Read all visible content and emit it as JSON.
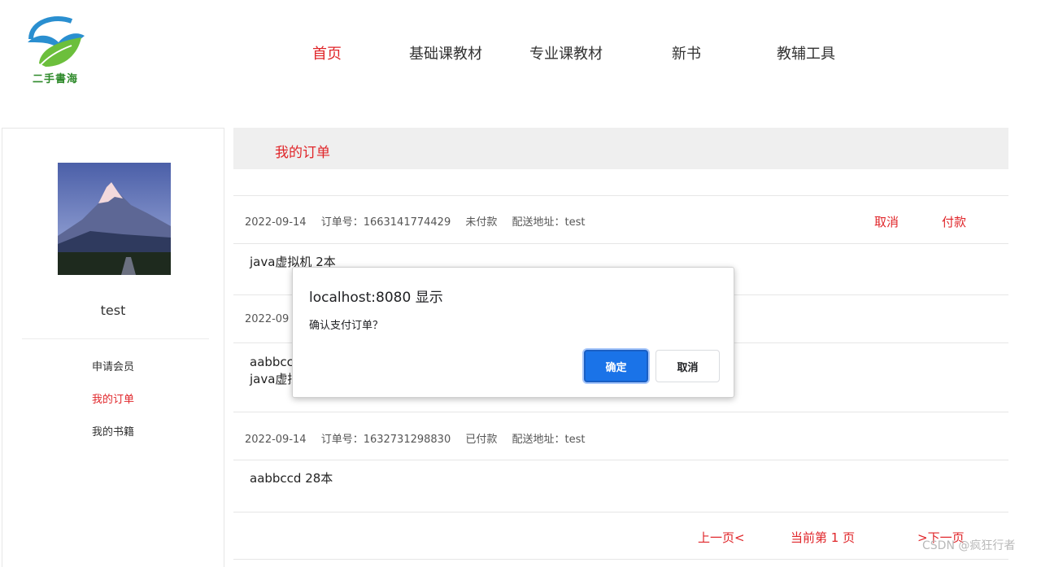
{
  "header": {
    "logo_text": "二手書海",
    "nav": [
      {
        "label": "首页",
        "active": true
      },
      {
        "label": "基础课教材",
        "active": false
      },
      {
        "label": "专业课教材",
        "active": false
      },
      {
        "label": "新书",
        "active": false
      },
      {
        "label": "教辅工具",
        "active": false
      }
    ]
  },
  "sidebar": {
    "username": "test",
    "links": [
      {
        "label": "申请会员",
        "active": false
      },
      {
        "label": "我的订单",
        "active": true
      },
      {
        "label": "我的书籍",
        "active": false
      }
    ]
  },
  "main": {
    "title": "我的订单",
    "orders": [
      {
        "date": "2022-09-14",
        "order_no": "订单号：1663141774429",
        "status": "未付款",
        "address": "配送地址：test",
        "actions": [
          "取消",
          "付款"
        ],
        "items": [
          "java虚拟机 2本"
        ]
      },
      {
        "date": "2022-09",
        "items": [
          "aabbcc",
          "java虚拟"
        ]
      },
      {
        "date": "2022-09-14",
        "order_no": "订单号：1632731298830",
        "status": "已付款",
        "address": "配送地址：test",
        "items": [
          "aabbccd 28本"
        ]
      }
    ],
    "pager": {
      "prev": "上一页<",
      "current": "当前第 1 页",
      "next": ">下一页"
    }
  },
  "dialog": {
    "title": "localhost:8080 显示",
    "message": "确认支付订单？",
    "ok": "确定",
    "cancel": "取消"
  },
  "watermark": "CSDN @疯狂行者",
  "colors": {
    "accent": "#e0262a",
    "primary_button": "#1a73e8",
    "header_bar": "#efefef"
  }
}
